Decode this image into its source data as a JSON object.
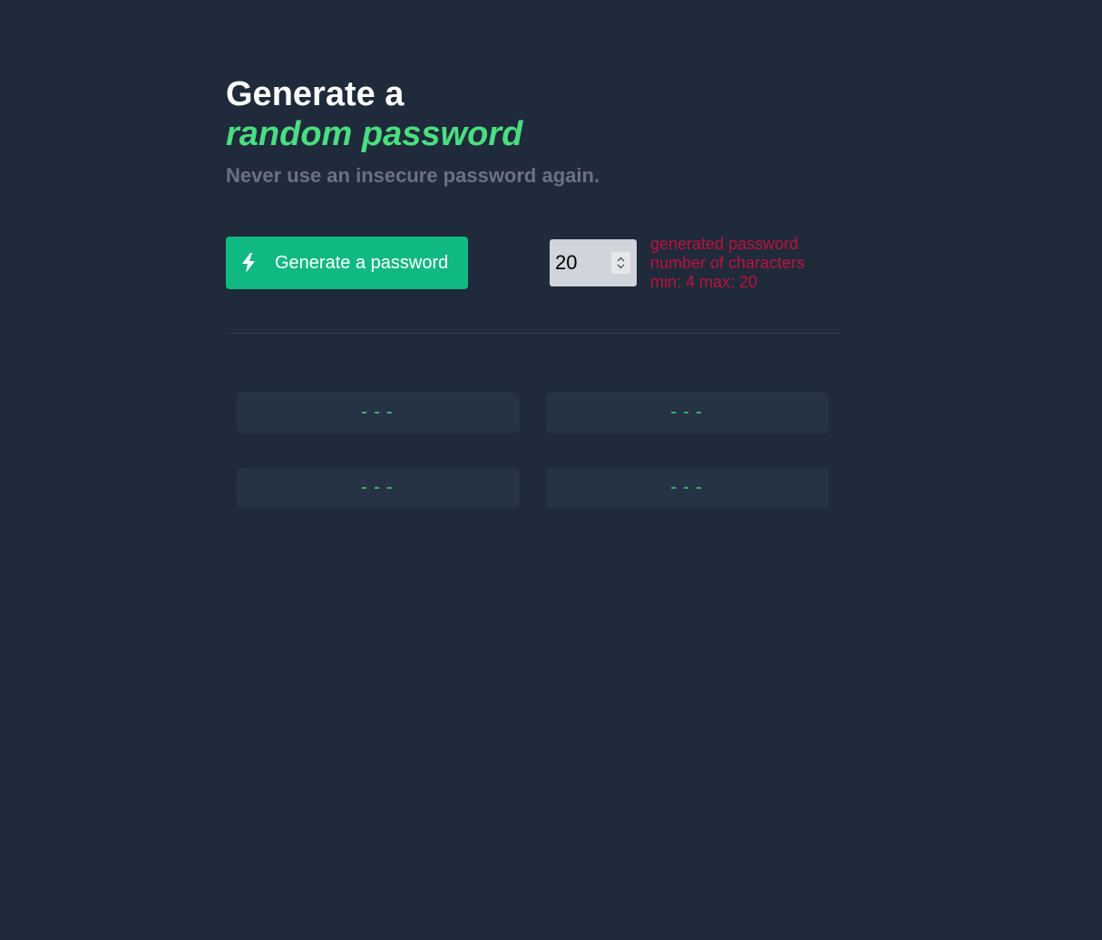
{
  "header": {
    "title_line1": "Generate a",
    "title_line2": "random password",
    "subtitle": "Never use an insecure password again."
  },
  "controls": {
    "generate_button_label": "Generate a password",
    "generate_icon": "lightning-bolt-icon",
    "length_value": "20",
    "hint_line1": "generated password",
    "hint_line2": "number of characters",
    "hint_line3": "min: 4 max: 20"
  },
  "passwords": [
    {
      "value": "---"
    },
    {
      "value": "---"
    },
    {
      "value": "---"
    },
    {
      "value": "---"
    }
  ],
  "colors": {
    "background": "#1f2a3b",
    "accent_green": "#4ade80",
    "button": "#10b981",
    "hint_red": "#be123c",
    "subtitle_gray": "#6b7280"
  }
}
